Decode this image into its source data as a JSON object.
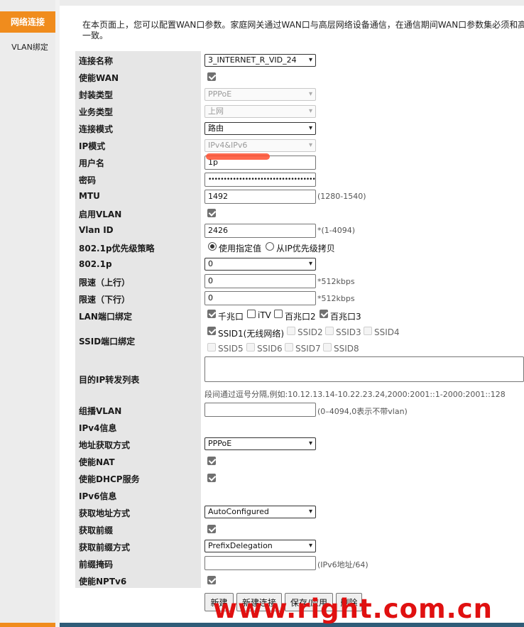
{
  "sidebar": {
    "active_item": "网络连接",
    "sub_item": "VLAN绑定"
  },
  "intro": {
    "line1": "在本页面上，您可以配置WAN口参数。家庭网关通过WAN口与高层网络设备通信，在通信期间WAN口参数集必须和高",
    "line2": "一致。"
  },
  "form": {
    "labels": {
      "conn_name": "连接名称",
      "enable_wan": "使能WAN",
      "encap": "封装类型",
      "service": "业务类型",
      "conn_mode": "连接模式",
      "ip_mode": "IP模式",
      "username": "用户名",
      "password": "密码",
      "mtu": "MTU",
      "enable_vlan": "启用VLAN",
      "vlan_id": "Vlan ID",
      "prio_policy": "802.1p优先级策略",
      "dot1p": "802.1p",
      "rate_up": "限速（上行）",
      "rate_down": "限速（下行）",
      "lan_bind": "LAN端口绑定",
      "ssid_bind": "SSID端口绑定",
      "dest_ip": "目的IP转发列表",
      "mcast_vlan": "组播VLAN",
      "ipv4_info": "IPv4信息",
      "addr_method": "地址获取方式",
      "enable_nat": "使能NAT",
      "enable_dhcp": "使能DHCP服务",
      "ipv6_info": "IPv6信息",
      "v6_addr_method": "获取地址方式",
      "get_prefix": "获取前缀",
      "prefix_method": "获取前缀方式",
      "prefix_mask": "前缀掩码",
      "enable_nptv6": "使能NPTv6"
    },
    "values": {
      "conn_name": "3_INTERNET_R_VID_24",
      "encap": "PPPoE",
      "service": "上网",
      "conn_mode": "路由",
      "ip_mode": "IPv4&IPv6",
      "username": "1p",
      "password": "•••••••••••••••••••••••••••••••••••••••••",
      "mtu": "1492",
      "vlan_id": "2426",
      "dot1p": "0",
      "rate_up": "0",
      "rate_down": "0",
      "mcast_vlan": "",
      "addr_method": "PPPoE",
      "v6_addr_method": "AutoConfigured",
      "prefix_method": "PrefixDelegation",
      "prefix_mask": ""
    },
    "hints": {
      "mtu": "(1280-1540)",
      "vlan_id": "*(1-4094)",
      "rate_up": "*512kbps",
      "rate_down": "*512kbps",
      "dest_ip": "段间通过逗号分隔,例如:10.12.13.14-10.22.23.24,2000:2001::1-2000:2001::128",
      "mcast_vlan": "(0–4094,0表示不带vlan)",
      "prefix_mask": "(IPv6地址/64)"
    },
    "radio": {
      "opt1": "使用指定值",
      "opt2": "从IP优先级拷贝"
    },
    "lan_ports": [
      "千兆口",
      "iTV",
      "百兆口2",
      "百兆口3"
    ],
    "ssids": [
      "SSID1(无线网络)",
      "SSID2",
      "SSID3",
      "SSID4",
      "SSID5",
      "SSID6",
      "SSID7",
      "SSID8"
    ]
  },
  "buttons": {
    "new": "新建",
    "new_conn": "新建连接",
    "save": "保存/应用",
    "delete": "删除"
  },
  "watermark": "www.right.com.cn",
  "colors": {
    "accent": "#f08c1d",
    "footer": "#2f5c78",
    "watermark": "#e01010"
  }
}
